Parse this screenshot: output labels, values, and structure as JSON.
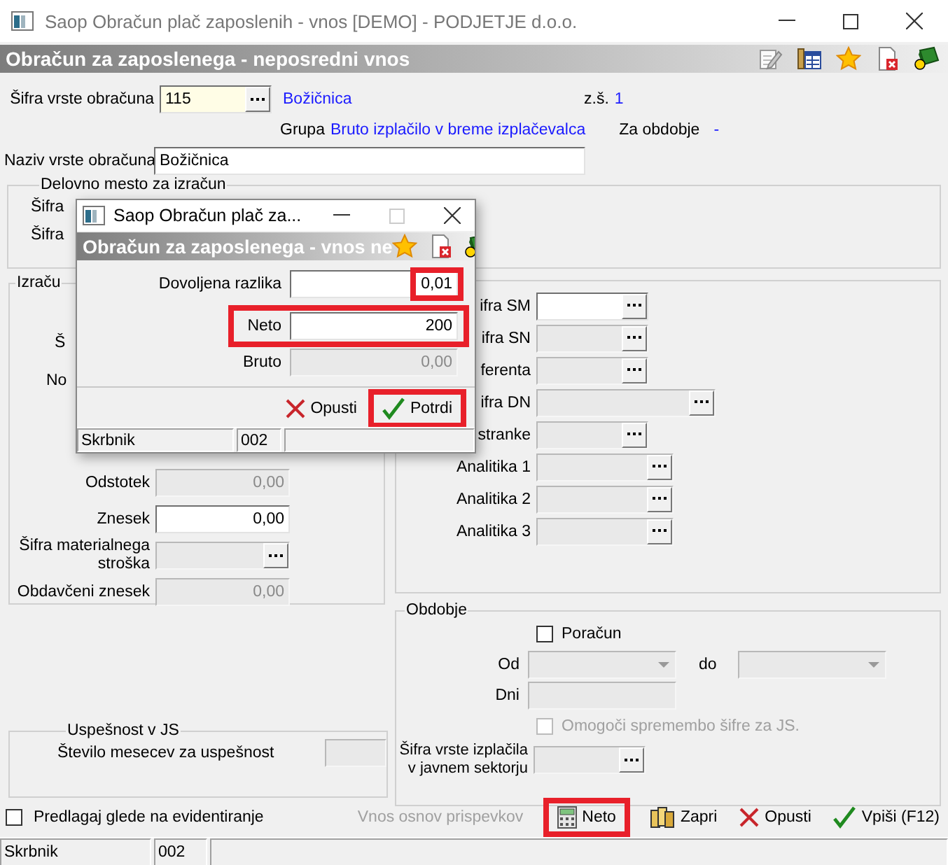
{
  "window": {
    "title": "Saop Obračun plač zaposlenih - vnos [DEMO] - PODJETJE d.o.o."
  },
  "header": {
    "title": "Obračun za zaposlenega - neposredni vnos"
  },
  "top": {
    "code_label": "Šifra vrste obračuna",
    "code_value": "115",
    "code_name": "Božičnica",
    "zs_label": "z.š.",
    "zs_value": "1",
    "group_label": "Grupa",
    "group_value": "Bruto izplačilo v breme izplačevalca",
    "period_label": "Za obdobje",
    "period_value": "-",
    "name_label": "Naziv vrste obračuna",
    "name_value": "Božičnica"
  },
  "workplace_group": {
    "legend": "Delovno mesto za izračun",
    "labels": [
      "Šifra",
      "Šifra"
    ]
  },
  "calc_group": {
    "legend": "Izraču",
    "rows": [
      {
        "label": "Š",
        "kind": "label"
      },
      {
        "label": "No",
        "kind": "label"
      },
      {
        "label": "Odstotek",
        "kind": "number",
        "value": "0,00",
        "disabled": true
      },
      {
        "label": "Znesek",
        "kind": "number",
        "value": "0,00",
        "disabled": false
      },
      {
        "label": "Šifra materialnega stroška",
        "kind": "lookup",
        "disabled": true
      },
      {
        "label": "Obdavčeni znesek",
        "kind": "number",
        "value": "0,00",
        "disabled": true
      }
    ]
  },
  "codes_group": {
    "rows": [
      {
        "label": "ifra SM",
        "kind": "short",
        "disabled": false
      },
      {
        "label": "ifra SN",
        "kind": "short",
        "disabled": true
      },
      {
        "label": "ferenta",
        "kind": "short",
        "disabled": true
      },
      {
        "label": "ifra DN",
        "kind": "long",
        "disabled": true
      },
      {
        "label": "stranke",
        "kind": "short",
        "disabled": true
      },
      {
        "label": "Analitika 1",
        "kind": "medium",
        "disabled": true
      },
      {
        "label": "Analitika 2",
        "kind": "medium",
        "disabled": true
      },
      {
        "label": "Analitika 3",
        "kind": "medium",
        "disabled": true
      }
    ]
  },
  "period_group": {
    "legend": "Obdobje",
    "recalc": {
      "label": "Poračun",
      "checked": false
    },
    "from_label": "Od",
    "to_label": "do",
    "days_label": "Dni",
    "allow_change": {
      "label": "Omogoči spremembo šifre za JS.",
      "checked": false,
      "disabled": true
    },
    "payout_label": "Šifra vrste izplačila v javnem sektorju"
  },
  "success_group": {
    "legend": "Uspešnost v JS",
    "label": "Število mesecev za uspešnost"
  },
  "bottom": {
    "suggest": {
      "label": "Predlagaj glede na evidentiranje",
      "checked": false
    },
    "buttons": [
      {
        "label": "Vnos osnov prispevkov",
        "kind": "plain",
        "disabled": true,
        "highlighted": false
      },
      {
        "label": "Neto",
        "kind": "calculator",
        "disabled": false,
        "highlighted": true
      },
      {
        "label": "Zapri",
        "kind": "close",
        "disabled": false,
        "highlighted": false
      },
      {
        "label": "Opusti",
        "kind": "cancel",
        "disabled": false,
        "highlighted": false
      },
      {
        "label": "Vpiši (F12)",
        "kind": "confirm",
        "disabled": false,
        "highlighted": false
      }
    ]
  },
  "status_bar": [
    "Skrbnik",
    "002"
  ],
  "dialog": {
    "title": "Saop Obračun plač za...",
    "header": "Obračun za zaposlenega - vnos ne",
    "fields": [
      {
        "label": "Dovoljena razlika",
        "value": "0,01",
        "disabled": false,
        "value_highlighted": true,
        "row_highlighted": false
      },
      {
        "label": "Neto",
        "value": "200",
        "disabled": false,
        "value_highlighted": false,
        "row_highlighted": true
      },
      {
        "label": "Bruto",
        "value": "0,00",
        "disabled": true,
        "value_highlighted": false,
        "row_highlighted": false
      }
    ],
    "buttons": [
      {
        "label": "Opusti",
        "kind": "cancel",
        "highlighted": false
      },
      {
        "label": "Potrdi",
        "kind": "confirm",
        "highlighted": true
      }
    ],
    "status_bar": [
      "Skrbnik",
      "002"
    ]
  }
}
